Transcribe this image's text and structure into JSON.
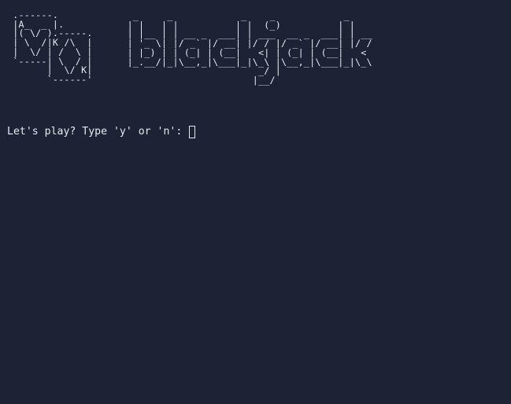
{
  "terminal": {
    "cards_art": " .------.\n |A_  _ |.\n |( \\/ ).-----.\n | \\  /|K /\\  |\n |  \\/ | /  \\ |\n `-----| \\  / |\n       |  \\/ K|\n       `------'",
    "logo_art": " _     _            _    _            _\n| |   | |          | |  (_)          | |\n| |__ | | __ _  ___| | ___  __ _  ___| | __\n| '_ \\| |/ _` |/ __| |/ / |/ _` |/ __| |/ /\n| |_) | | (_| | (__|   <| | (_| | (__|   <\n|_.__/|_|\\__,_|\\___|_|\\_\\ |\\__,_|\\___|_|\\_\\\n                       _/ |\n                      |__/",
    "prompt": "Let's play? Type 'y' or 'n': ",
    "input_value": ""
  }
}
